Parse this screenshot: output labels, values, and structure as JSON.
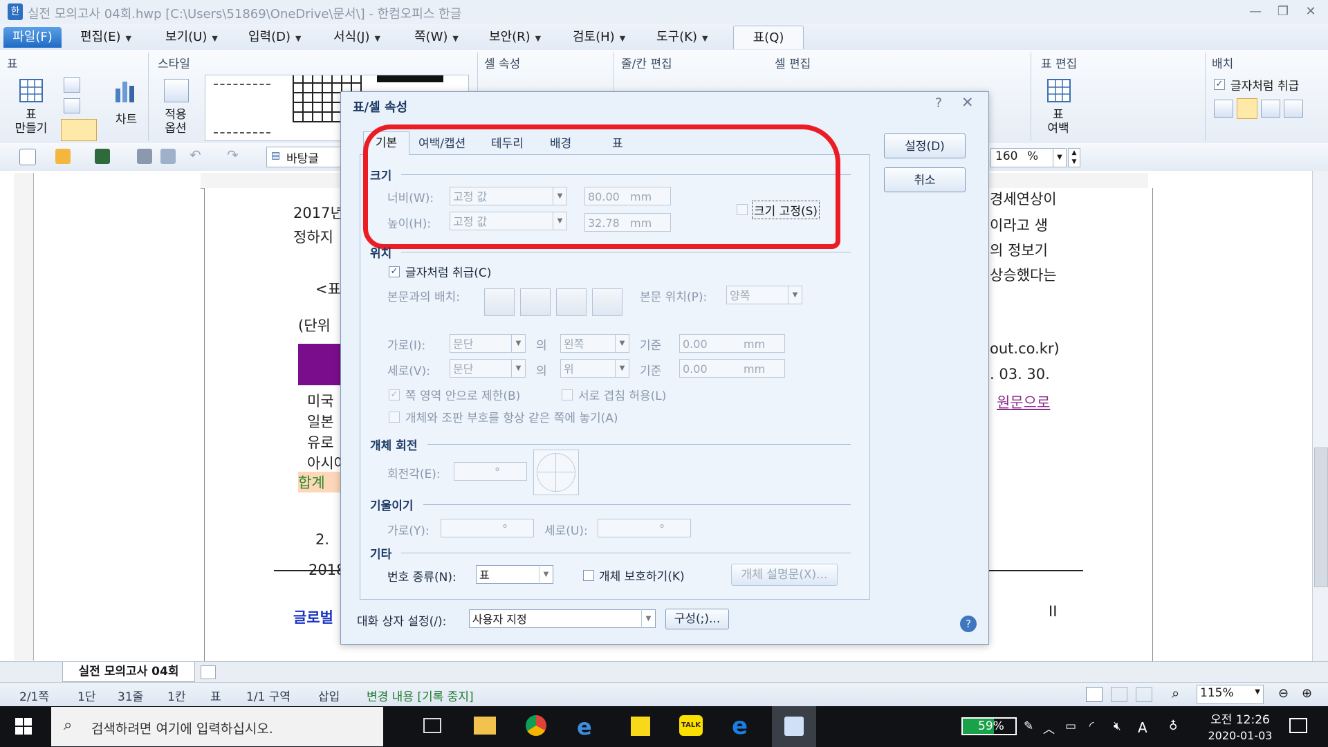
{
  "window": {
    "title": "실전 모의고사 04회.hwp [C:\\Users\\51869\\OneDrive\\문서\\] - 한컴오피스 한글",
    "controls": [
      "—",
      "❐",
      "✕"
    ],
    "help_controls": [
      "︿",
      "?",
      "✕"
    ]
  },
  "menu": {
    "items": [
      "파일(F)",
      "편집(E)",
      "보기(U)",
      "입력(D)",
      "서식(J)",
      "쪽(W)",
      "보안(R)",
      "검토(H)",
      "도구(K)",
      "표(Q)"
    ]
  },
  "ribbon": {
    "groups": [
      "표",
      "스타일",
      "셀 속성",
      "줄/칸 편집",
      "셀 편집",
      "표 편집",
      "배치"
    ],
    "make_table_label": "표\n만들기",
    "chart_label": "차트",
    "apply_options_label": "적용\n옵션",
    "table_margin_label": "표\n여백",
    "treat_as_char": "글자처럼 취급"
  },
  "toolbar": {
    "style_name": "바탕글",
    "zoom_value": "160",
    "zoom_unit": "%"
  },
  "document": {
    "left_lines": [
      "2017년",
      "정하지",
      "<표",
      "(단위",
      "미국",
      "일본",
      "유로",
      "아시아",
      "합계",
      "2.",
      "2018",
      "글로벌"
    ],
    "right_lines": [
      "경세연상이",
      "이라고 생",
      "의 정보기",
      "상승했다는",
      "out.co.kr)",
      ". 03. 30.",
      "원문으로"
    ],
    "footer_mark": "II"
  },
  "doc_tab": {
    "name": "실전 모의고사 04회"
  },
  "status": {
    "page": "2/1쪽",
    "column": "1단",
    "line": "31줄",
    "col": "1칸",
    "object": "표",
    "section": "1/1 구역",
    "mode": "삽입",
    "track": "변경 내용 [기록 중지]",
    "zoom": "115%"
  },
  "dialog": {
    "title": "표/셀 속성",
    "tabs": [
      "기본",
      "여백/캡션",
      "테두리",
      "배경",
      "표"
    ],
    "ok": "설정(D)",
    "cancel": "취소",
    "size": {
      "section": "크기",
      "width_label": "너비(W):",
      "width_mode": "고정 값",
      "width_value": "80.00",
      "height_label": "높이(H):",
      "height_mode": "고정 값",
      "height_value": "32.78",
      "unit": "mm",
      "fix_size": "크기 고정(S)"
    },
    "position": {
      "section": "위치",
      "treat_as_char": "글자처럼 취급(C)",
      "wrap_label": "본문과의 배치:",
      "body_pos_label": "본문 위치(P):",
      "body_pos_value": "양쪽",
      "horiz_label": "가로(I):",
      "horiz_ref": "문단",
      "horiz_of": "의",
      "horiz_align": "왼쪽",
      "horiz_base": "기준",
      "horiz_value": "0.00",
      "vert_label": "세로(V):",
      "vert_ref": "문단",
      "vert_of": "의",
      "vert_align": "위",
      "vert_base": "기준",
      "vert_value": "0.00",
      "unit": "mm",
      "limit_page": "쪽 영역 안으로 제한(B)",
      "allow_overlap": "서로 겹침 허용(L)",
      "same_page": "개체와 조판 부호를 항상 같은 쪽에 놓기(A)"
    },
    "rotation": {
      "section": "개체 회전",
      "angle_label": "회전각(E):",
      "angle_unit": "°"
    },
    "skew": {
      "section": "기울이기",
      "horiz_label": "가로(Y):",
      "vert_label": "세로(U):",
      "unit": "°"
    },
    "other": {
      "section": "기타",
      "number_type_label": "번호 종류(N):",
      "number_type_value": "표",
      "protect": "개체 보호하기(K)",
      "description": "개체 설명문(X)..."
    },
    "footer": {
      "dialog_setting_label": "대화 상자 설정(/):",
      "dialog_setting_value": "사용자 지정",
      "configure": "구성(;)..."
    }
  },
  "taskbar": {
    "search_placeholder": "검색하려면 여기에 입력하십시오.",
    "battery": "59%",
    "ime": "A",
    "time": "오전 12:26",
    "date": "2020-01-03"
  },
  "colors": {
    "accent": "#1f6ac6",
    "highlight_box": "#ec1c24",
    "table_header": "#7a0d8c"
  }
}
